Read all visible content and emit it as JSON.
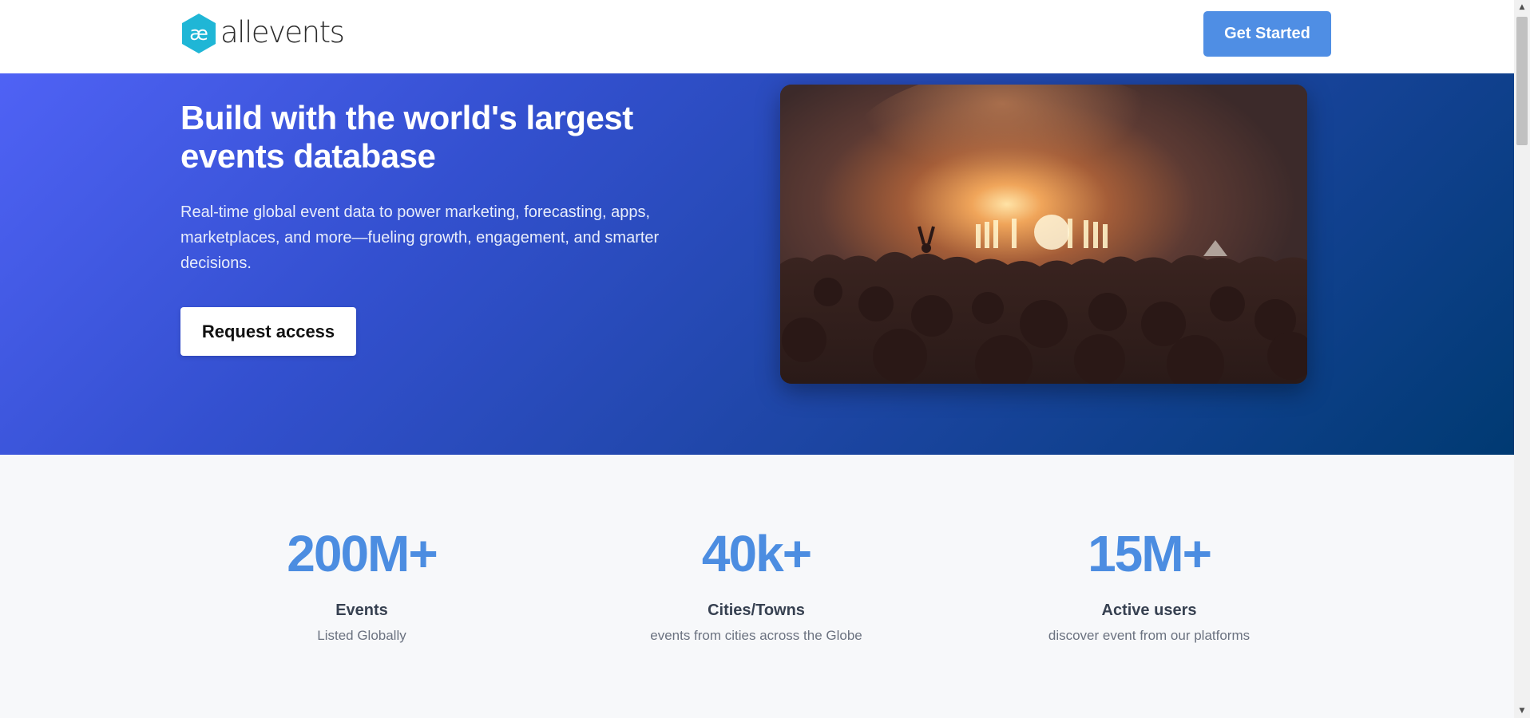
{
  "header": {
    "logo_text": "allevents",
    "logo_mark": "æ",
    "cta_label": "Get Started"
  },
  "hero": {
    "title": "Build with the world's largest events database",
    "description": "Real-time global event data to power marketing, forecasting, apps, marketplaces, and more—fueling growth, engagement, and smarter decisions.",
    "button_label": "Request access",
    "image_icon": "concert-crowd-photo"
  },
  "stats": [
    {
      "value": "200M+",
      "label": "Events",
      "sub": "Listed Globally"
    },
    {
      "value": "40k+",
      "label": "Cities/Towns",
      "sub": "events from cities across the Globe"
    },
    {
      "value": "15M+",
      "label": "Active users",
      "sub": "discover event from our platforms"
    }
  ],
  "colors": {
    "brand_teal": "#1fb6d6",
    "cta_blue": "#4f8ee4",
    "stat_blue": "#4c8de1",
    "hero_gradient_start": "#4f62f5",
    "hero_gradient_end": "#003a72"
  },
  "scrollbar": {
    "up_arrow": "▲",
    "down_arrow": "▼"
  }
}
